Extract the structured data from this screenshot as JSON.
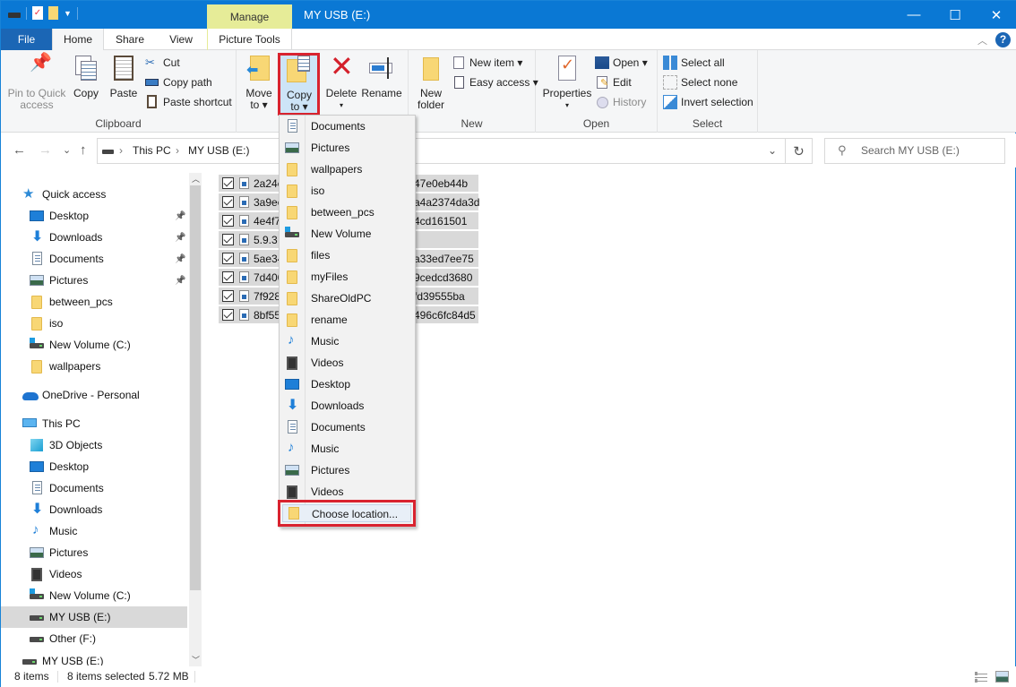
{
  "window": {
    "title": "MY USB (E:)",
    "context_tab": "Manage",
    "controls": {
      "minimize": "—",
      "maximize": "☐",
      "close": "✕"
    }
  },
  "ribbon_tabs": [
    {
      "label": "File"
    },
    {
      "label": "Home",
      "active": true
    },
    {
      "label": "Share"
    },
    {
      "label": "View"
    },
    {
      "label": "Picture Tools"
    }
  ],
  "ribbon": {
    "clipboard": {
      "label": "Clipboard",
      "pin": "Pin to Quick access",
      "pin_l1": "Pin to Quick",
      "pin_l2": "access",
      "copy": "Copy",
      "paste": "Paste",
      "cut": "Cut",
      "copy_path": "Copy path",
      "paste_shortcut": "Paste shortcut"
    },
    "organize": {
      "move_l1": "Move",
      "move_l2": "to ▾",
      "copy_l1": "Copy",
      "copy_l2": "to ▾",
      "delete": "Delete",
      "delete_arrow": "▾",
      "rename": "Rename"
    },
    "new": {
      "label": "New",
      "new_folder_l1": "New",
      "new_folder_l2": "folder",
      "new_item": "New item ▾",
      "easy_access": "Easy access ▾"
    },
    "open": {
      "label": "Open",
      "properties": "Properties",
      "properties_arrow": "▾",
      "open": "Open ▾",
      "edit": "Edit",
      "history": "History"
    },
    "select": {
      "label": "Select",
      "select_all": "Select all",
      "select_none": "Select none",
      "invert": "Invert selection"
    }
  },
  "navigation": {
    "back": "←",
    "forward": "→",
    "recent": "⌄",
    "up": "↑",
    "breadcrumb": [
      "This PC",
      "MY USB (E:)"
    ],
    "separator": "›",
    "refresh": "↻",
    "dropdown": "⌄",
    "search_placeholder": "Search MY USB (E:)"
  },
  "sidebar": {
    "items": [
      {
        "label": "Quick access",
        "icon": "star",
        "level": 0
      },
      {
        "label": "Desktop",
        "icon": "desktop",
        "level": 1,
        "pinned": true
      },
      {
        "label": "Downloads",
        "icon": "downloads",
        "level": 1,
        "pinned": true
      },
      {
        "label": "Documents",
        "icon": "documents",
        "level": 1,
        "pinned": true
      },
      {
        "label": "Pictures",
        "icon": "pictures",
        "level": 1,
        "pinned": true
      },
      {
        "label": "between_pcs",
        "icon": "folder",
        "level": 1
      },
      {
        "label": "iso",
        "icon": "folder",
        "level": 1
      },
      {
        "label": "New Volume (C:)",
        "icon": "drive-windows",
        "level": 1
      },
      {
        "label": "wallpapers",
        "icon": "folder",
        "level": 1
      },
      {
        "label": "OneDrive - Personal",
        "icon": "onedrive",
        "level": 0
      },
      {
        "label": "This PC",
        "icon": "pc",
        "level": 0
      },
      {
        "label": "3D Objects",
        "icon": "3d-objects",
        "level": 1
      },
      {
        "label": "Desktop",
        "icon": "desktop",
        "level": 1
      },
      {
        "label": "Documents",
        "icon": "documents",
        "level": 1
      },
      {
        "label": "Downloads",
        "icon": "downloads",
        "level": 1
      },
      {
        "label": "Music",
        "icon": "music",
        "level": 1
      },
      {
        "label": "Pictures",
        "icon": "pictures",
        "level": 1
      },
      {
        "label": "Videos",
        "icon": "videos",
        "level": 1
      },
      {
        "label": "New Volume (C:)",
        "icon": "drive-windows",
        "level": 1
      },
      {
        "label": "MY USB (E:)",
        "icon": "drive",
        "level": 1,
        "selected": true
      },
      {
        "label": "Other (F:)",
        "icon": "drive",
        "level": 1
      },
      {
        "label": "MY USB (E:)",
        "icon": "drive",
        "level": 0,
        "partial": true
      }
    ]
  },
  "files": [
    {
      "name_start": "2a24e",
      "name_end": "47e0eb44b",
      "checked": true
    },
    {
      "name_start": "3a9ee",
      "name_end": "a4a2374da3d",
      "checked": true
    },
    {
      "name_start": "4e4f7",
      "name_end": "4cd161501",
      "checked": true
    },
    {
      "name_start": "5.9.3 v",
      "name_end": "",
      "checked": true
    },
    {
      "name_start": "5ae34",
      "name_end": "a33ed7ee75",
      "checked": true
    },
    {
      "name_start": "7d400",
      "name_end": "9cedcd3680",
      "checked": true
    },
    {
      "name_start": "7f928",
      "name_end": "fd39555ba",
      "checked": true
    },
    {
      "name_start": "8bf55",
      "name_end": "496c6fc84d5",
      "checked": true
    }
  ],
  "copy_to_menu": {
    "items": [
      {
        "label": "Documents",
        "icon": "documents"
      },
      {
        "label": "Pictures",
        "icon": "pictures"
      },
      {
        "label": "wallpapers",
        "icon": "folder"
      },
      {
        "label": "iso",
        "icon": "folder"
      },
      {
        "label": "between_pcs",
        "icon": "folder"
      },
      {
        "label": "New Volume",
        "icon": "drive-windows"
      },
      {
        "label": "files",
        "icon": "folder"
      },
      {
        "label": "myFiles",
        "icon": "folder"
      },
      {
        "label": "ShareOldPC",
        "icon": "folder"
      },
      {
        "label": "rename",
        "icon": "folder"
      },
      {
        "label": "Music",
        "icon": "music"
      },
      {
        "label": "Videos",
        "icon": "videos"
      },
      {
        "label": "Desktop",
        "icon": "desktop"
      },
      {
        "label": "Downloads",
        "icon": "downloads"
      },
      {
        "label": "Documents",
        "icon": "documents"
      },
      {
        "label": "Music",
        "icon": "music"
      },
      {
        "label": "Pictures",
        "icon": "pictures"
      },
      {
        "label": "Videos",
        "icon": "videos"
      }
    ],
    "choose_location": "Choose location..."
  },
  "status_bar": {
    "item_count": "8 items",
    "selection": "8 items selected",
    "size": "5.72 MB"
  },
  "colors": {
    "titlebar": "#0a78d4",
    "file_tab": "#1b66b5",
    "manage_tab": "#e6ec98",
    "highlight_red": "#d9232f",
    "selection_gray": "#d9d9d9"
  }
}
